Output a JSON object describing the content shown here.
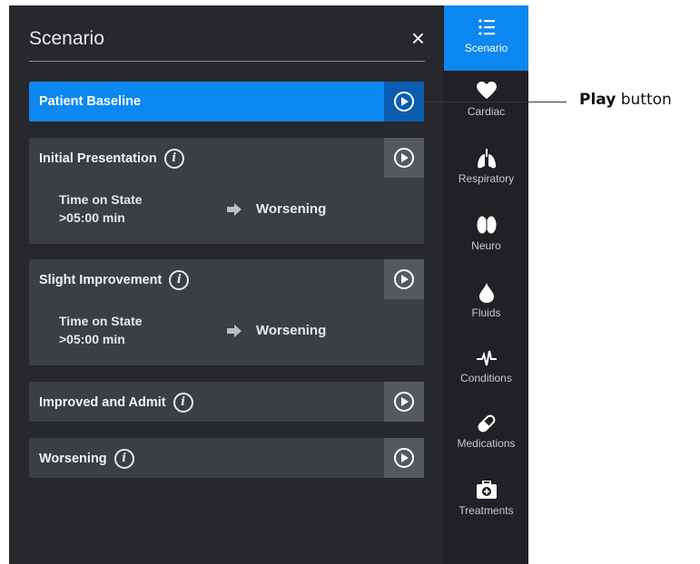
{
  "panel": {
    "title": "Scenario",
    "close_icon": "×"
  },
  "states": [
    {
      "name": "Patient Baseline",
      "active": true
    },
    {
      "name": "Initial Presentation",
      "time_label": "Time on State",
      "time_value": ">05:00 min",
      "next": "Worsening"
    },
    {
      "name": "Slight Improvement",
      "time_label": "Time on State",
      "time_value": ">05:00 min",
      "next": "Worsening"
    },
    {
      "name": "Improved and Admit"
    },
    {
      "name": "Worsening"
    }
  ],
  "info_icon": "i",
  "sidebar": {
    "items": [
      {
        "label": "Scenario",
        "icon": "list-icon"
      },
      {
        "label": "Cardiac",
        "icon": "heart-icon"
      },
      {
        "label": "Respiratory",
        "icon": "lungs-icon"
      },
      {
        "label": "Neuro",
        "icon": "brain-icon"
      },
      {
        "label": "Fluids",
        "icon": "droplet-icon"
      },
      {
        "label": "Conditions",
        "icon": "pulse-icon"
      },
      {
        "label": "Medications",
        "icon": "pill-icon"
      },
      {
        "label": "Treatments",
        "icon": "medkit-icon"
      }
    ]
  },
  "callout": {
    "bold": "Play",
    "rest": " button"
  },
  "colors": {
    "accent": "#0d87f2",
    "panel_bg": "#26282b",
    "card_bg": "#3b3e42"
  }
}
